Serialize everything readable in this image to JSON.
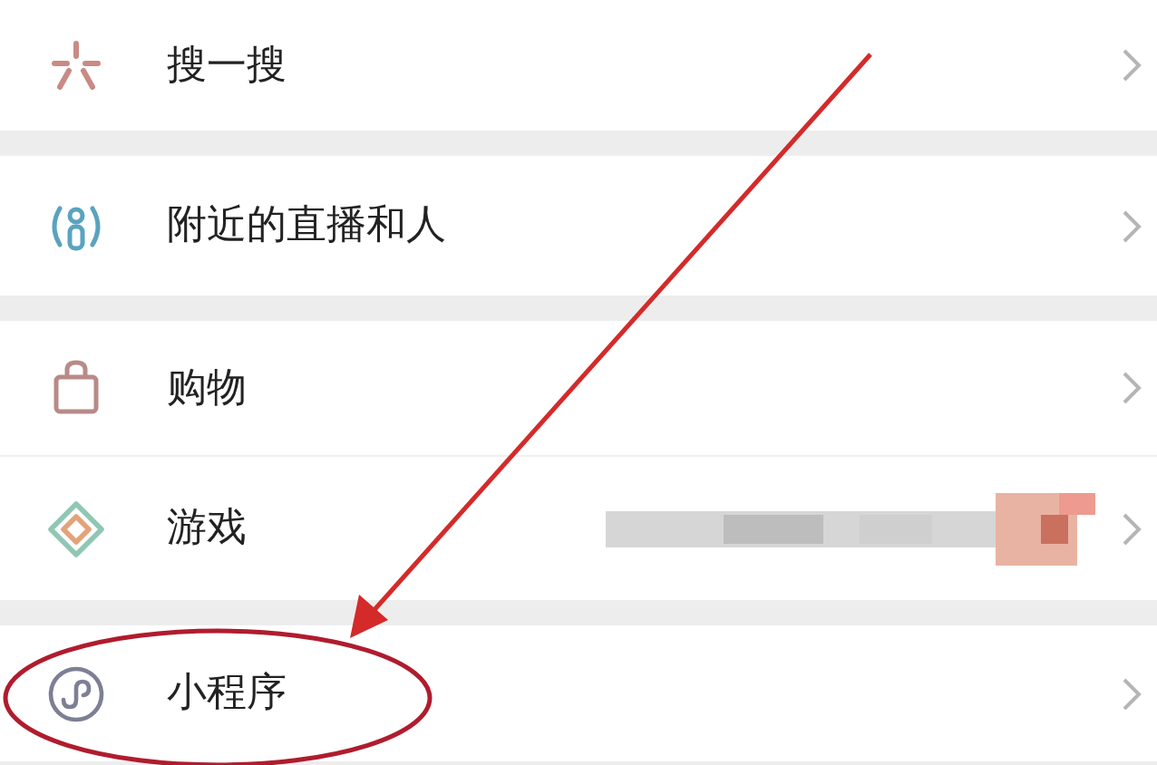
{
  "groups": [
    {
      "items": [
        {
          "label": "搜一搜"
        }
      ]
    },
    {
      "items": [
        {
          "label": "附近的直播和人"
        }
      ]
    },
    {
      "items": [
        {
          "label": "购物"
        },
        {
          "label": "游戏"
        }
      ]
    },
    {
      "items": [
        {
          "label": "小程序"
        }
      ]
    }
  ]
}
